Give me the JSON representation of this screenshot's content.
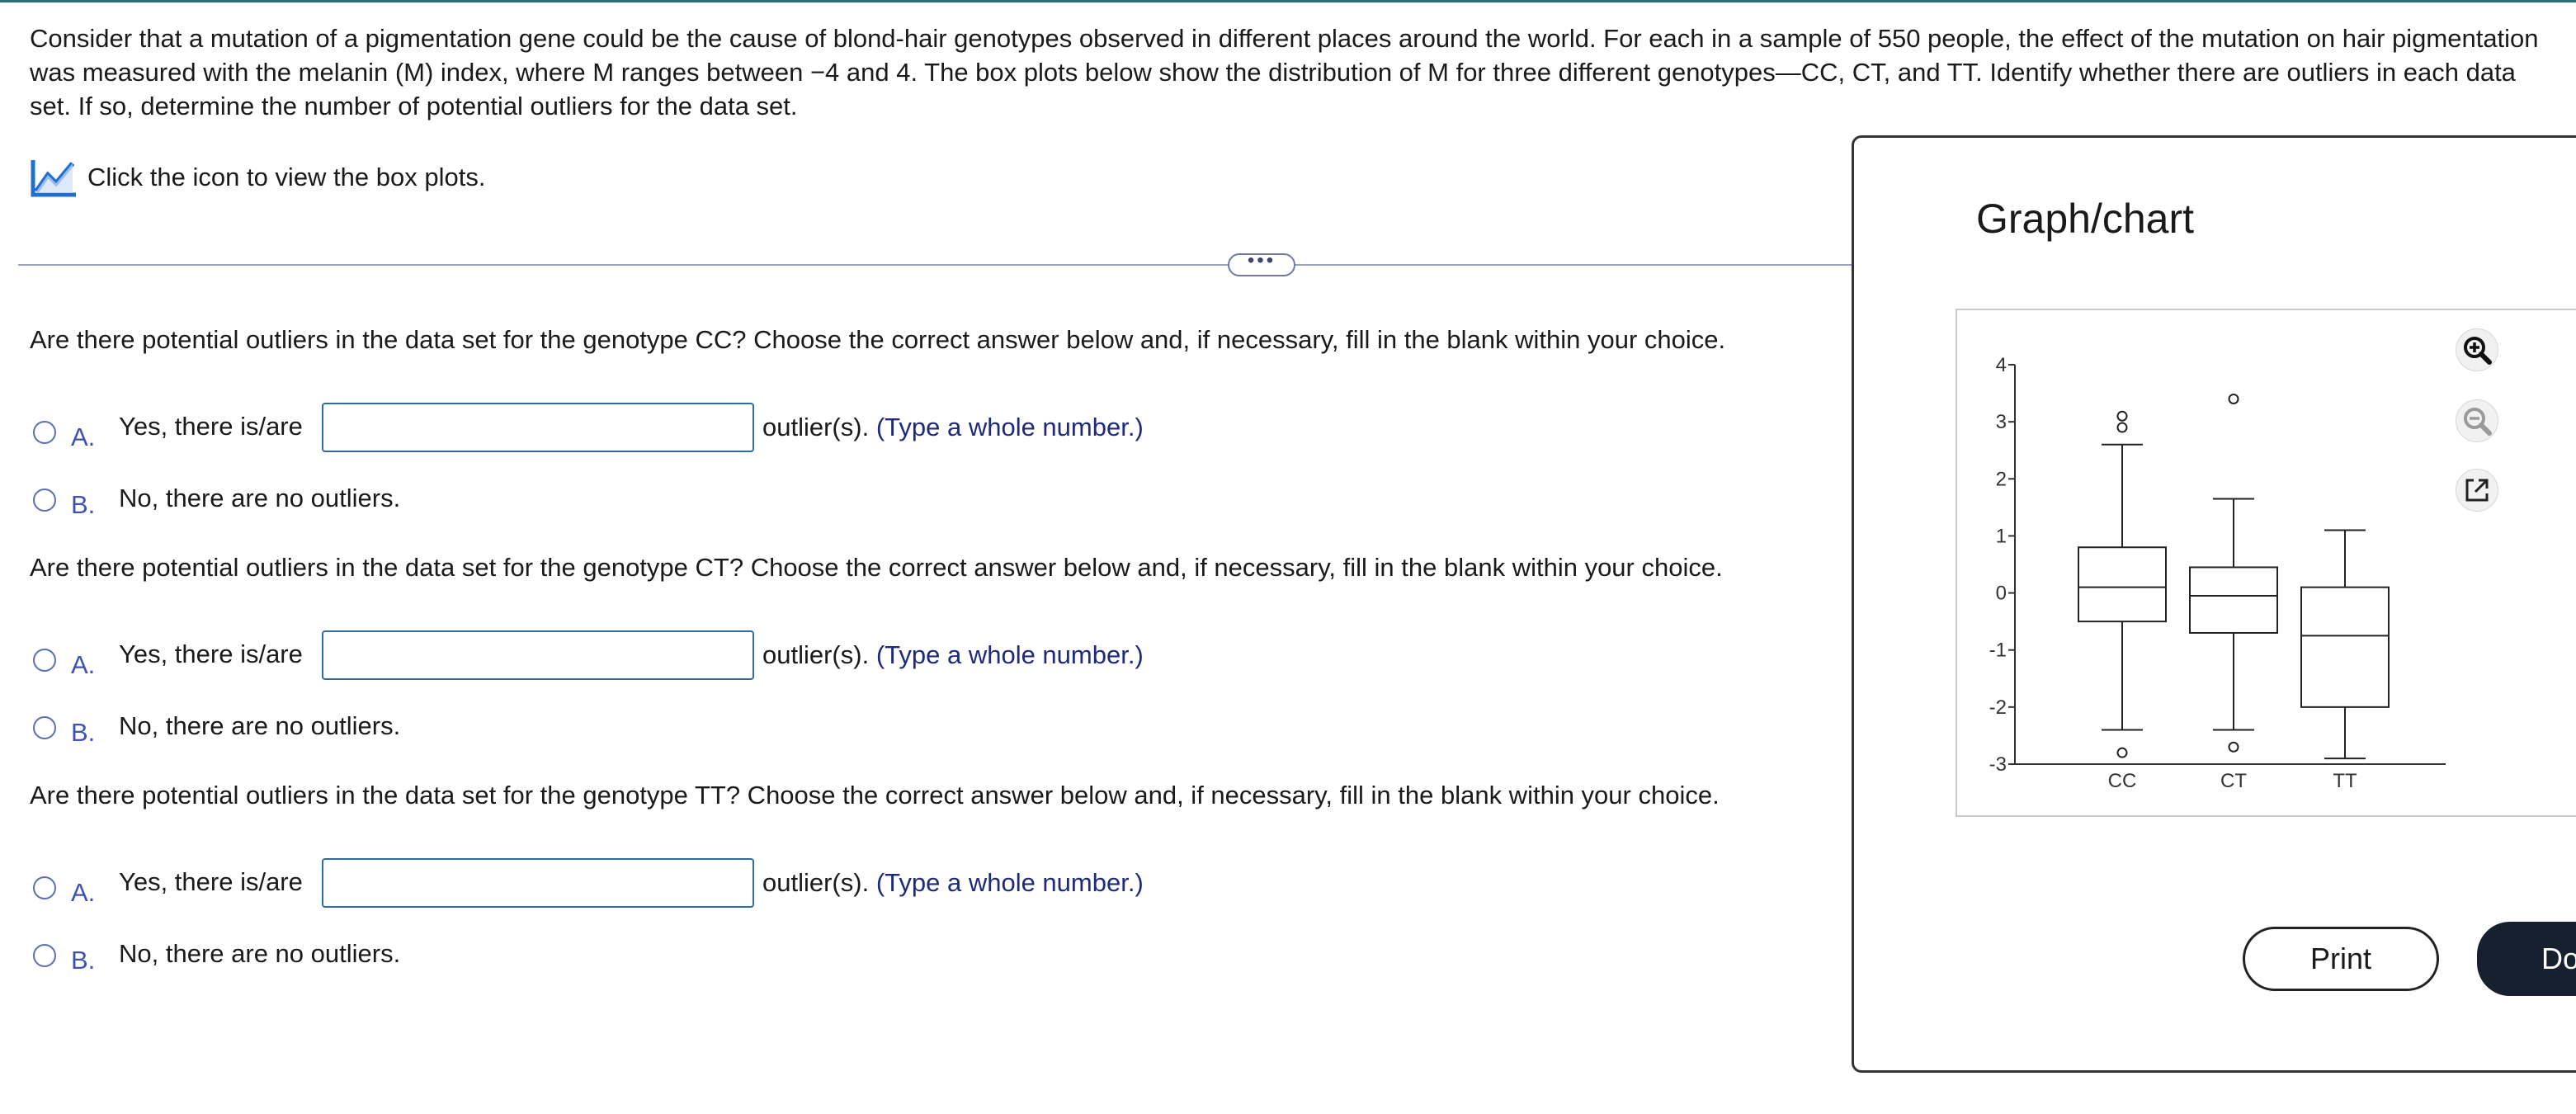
{
  "question": {
    "text": "Consider that a mutation of a pigmentation gene could be the cause of blond-hair genotypes observed in different places around the world. For each in a sample of 550 people, the effect of the mutation on hair pigmentation was measured with the melanin (M) index, where M ranges between −4 and 4. The box plots below show the distribution of M for three different genotypes—CC, CT, and TT. Identify whether there are outliers in each data set. If so, determine the number of potential outliers for the data set."
  },
  "icon_link": {
    "icon": "line-chart-icon",
    "label": "Click the icon to view the box plots."
  },
  "divider": {
    "label": "•••"
  },
  "parts": [
    {
      "prompt": "Are there potential outliers in the data set for the genotype CC? Choose the correct answer below and, if necessary, fill in the blank within your choice.",
      "option_a": {
        "letter": "A.",
        "text": "Yes, there is/are",
        "input_value": "",
        "after": "outlier(s).",
        "hint": "(Type a whole number.)"
      },
      "option_b": {
        "letter": "B.",
        "text": "No, there are no outliers."
      }
    },
    {
      "prompt": "Are there potential outliers in the data set for the genotype CT? Choose the correct answer below and, if necessary, fill in the blank within your choice.",
      "option_a": {
        "letter": "A.",
        "text": "Yes, there is/are",
        "input_value": "",
        "after": "outlier(s).",
        "hint": "(Type a whole number.)"
      },
      "option_b": {
        "letter": "B.",
        "text": "No, there are no outliers."
      }
    },
    {
      "prompt": "Are there potential outliers in the data set for the genotype TT? Choose the correct answer below and, if necessary, fill in the blank within your choice.",
      "option_a": {
        "letter": "A.",
        "text": "Yes, there is/are",
        "input_value": "",
        "after": "outlier(s).",
        "hint": "(Type a whole number.)"
      },
      "option_b": {
        "letter": "B.",
        "text": "No, there are no outliers."
      }
    }
  ],
  "panel": {
    "title": "Graph/chart",
    "tools": [
      "zoom-in-icon",
      "zoom-out-icon",
      "popout-icon"
    ],
    "print_label": "Print",
    "done_label": "Do"
  },
  "chart_data": {
    "type": "boxplot",
    "ylim": [
      -3,
      4
    ],
    "yticks": [
      "-3",
      "-2",
      "-1",
      "0",
      "1",
      "2",
      "3",
      "4"
    ],
    "categories": [
      "CC",
      "CT",
      "TT"
    ],
    "boxes": [
      {
        "name": "CC",
        "whisker_low": -2.4,
        "q1": -0.5,
        "median": 0.1,
        "q3": 0.8,
        "whisker_high": 2.6,
        "outliers": [
          3.1,
          2.9,
          -2.8
        ]
      },
      {
        "name": "CT",
        "whisker_low": -2.4,
        "q1": -0.7,
        "median": -0.05,
        "q3": 0.45,
        "whisker_high": 1.65,
        "outliers": [
          3.4,
          -2.7
        ]
      },
      {
        "name": "TT",
        "whisker_low": -2.9,
        "q1": -2.0,
        "median": -0.75,
        "q3": 0.1,
        "whisker_high": 1.1,
        "outliers": []
      }
    ]
  }
}
